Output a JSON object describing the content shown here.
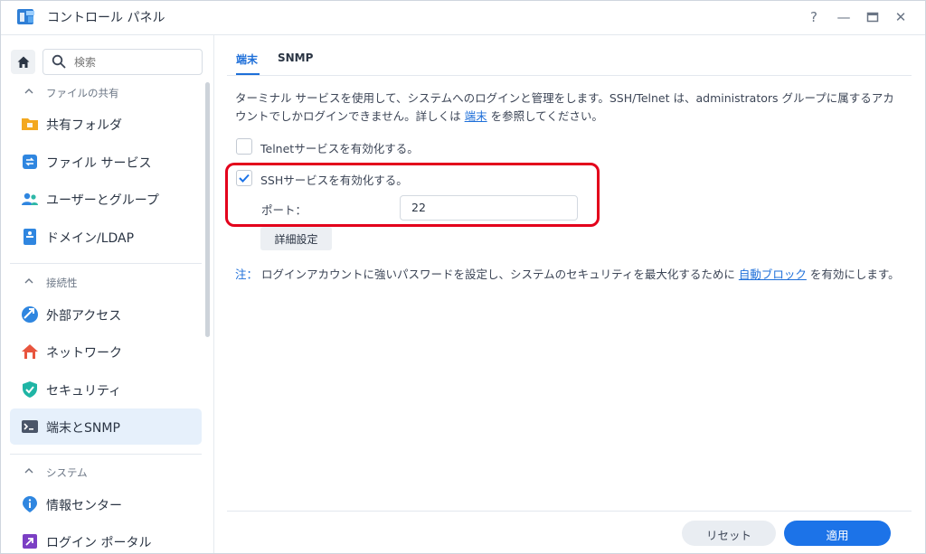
{
  "window": {
    "title": "コントロール パネル",
    "help_label": "?",
    "minimize_label": "—",
    "close_label": "✕"
  },
  "sidebar": {
    "search_placeholder": "検索",
    "sections": [
      {
        "label": "ファイルの共有",
        "items": [
          "共有フォルダ",
          "ファイル サービス",
          "ユーザーとグループ",
          "ドメイン/LDAP"
        ]
      },
      {
        "label": "接続性",
        "items": [
          "外部アクセス",
          "ネットワーク",
          "セキュリティ",
          "端末とSNMP"
        ]
      },
      {
        "label": "システム",
        "items": [
          "情報センター",
          "ログイン ポータル"
        ]
      }
    ],
    "active_item": "端末とSNMP"
  },
  "tabs": [
    "端末",
    "SNMP"
  ],
  "active_tab": "端末",
  "description": {
    "before_link": "ターミナル サービスを使用して、システムへのログインと管理をします。SSH/Telnet は、administrators グループに属するアカウントでしかログインできません。詳しくは ",
    "link": "端末",
    "after_link": " を参照してください。"
  },
  "telnet": {
    "label": "Telnetサービスを有効化する。",
    "checked": false
  },
  "ssh": {
    "label": "SSHサービスを有効化する。",
    "checked": true
  },
  "port": {
    "label": "ポート：",
    "value": "22"
  },
  "advanced_button": "詳細設定",
  "note": {
    "prefix": "注：",
    "before_link": " ログインアカウントに強いパスワードを設定し、システムのセキュリティを最大化するために ",
    "link": "自動ブロック",
    "after_link": " を有効にします。"
  },
  "buttons": {
    "reset": "リセット",
    "apply": "適用"
  },
  "colors": {
    "accent": "#1c73e8",
    "highlight_box": "#e3001b",
    "active_nav_bg": "#e6f0fb"
  }
}
